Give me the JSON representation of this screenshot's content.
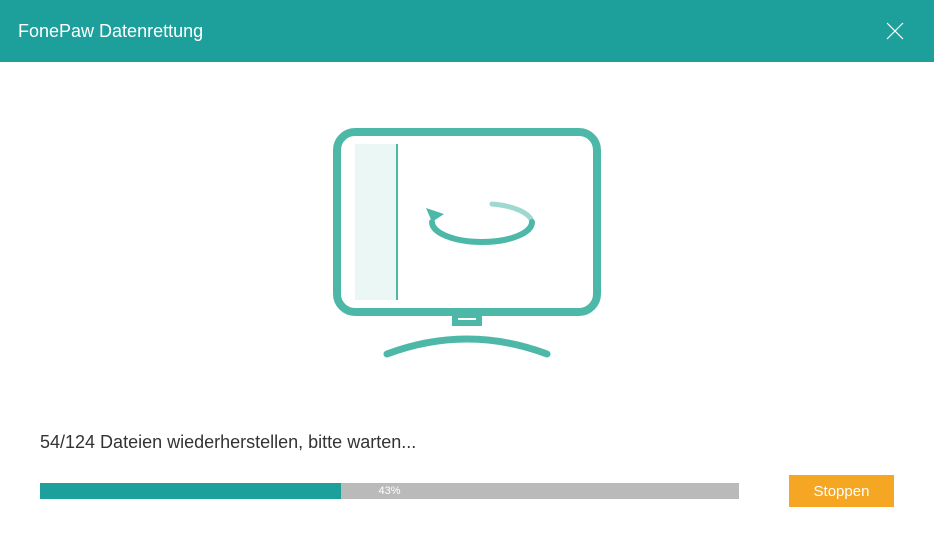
{
  "titlebar": {
    "title": "FonePaw Datenrettung"
  },
  "progress": {
    "status_text": "54/124 Dateien wiederherstellen, bitte warten...",
    "percent_label": "43%",
    "percent_value": 43
  },
  "buttons": {
    "stop_label": "Stoppen"
  }
}
